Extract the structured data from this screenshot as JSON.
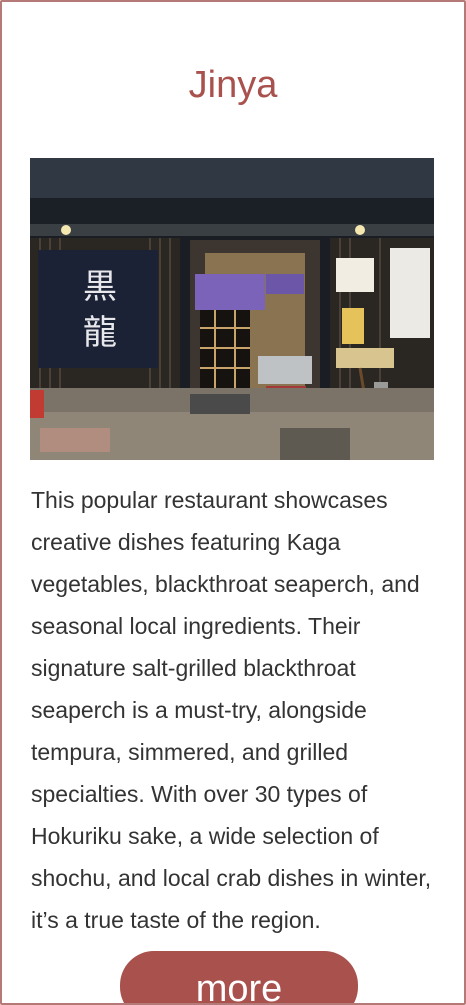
{
  "card": {
    "title": "Jinya",
    "image_alt": "Storefront of Jinya restaurant at night",
    "description": "This popular restaurant showcases creative dishes featuring Kaga vegetables, blackthroat seaperch, and seasonal local ingredients. Their signature salt-grilled blackthroat seaperch is a must-try, alongside tempura, simmered, and grilled specialties. With over 30 types of Hokuriku sake, a wide selection of shochu, and local crab dishes in winter, it’s a true taste of the region.",
    "more_label": "more"
  },
  "colors": {
    "accent": "#a8514d",
    "border": "#b57a78",
    "text": "#333333"
  }
}
